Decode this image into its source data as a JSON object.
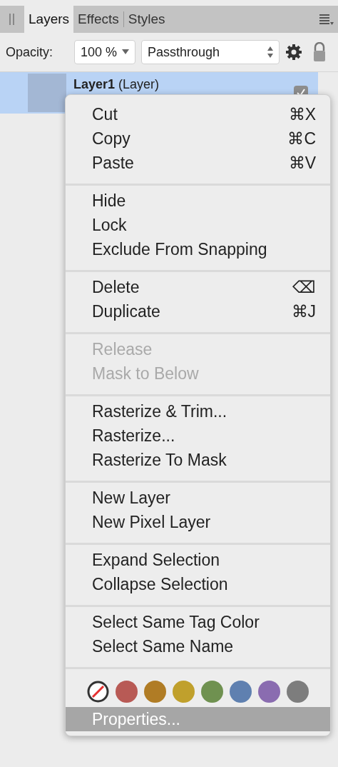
{
  "tabs": [
    {
      "label": "Layers",
      "selected": true
    },
    {
      "label": "Effects",
      "selected": false
    },
    {
      "label": "Styles",
      "selected": false
    }
  ],
  "toolbar": {
    "opacity_label": "Opacity:",
    "opacity_value": "100 %",
    "blend_mode": "Passthrough"
  },
  "layers": [
    {
      "name": "**Layer1** (Layer)",
      "selected": true,
      "visible": true
    }
  ],
  "context_menu": {
    "sections": [
      {
        "items": [
          {
            "label": "Cut",
            "shortcut": "⌘X",
            "disabled": false,
            "selected": false
          },
          {
            "label": "Copy",
            "shortcut": "⌘C",
            "disabled": false,
            "selected": false
          },
          {
            "label": "Paste",
            "shortcut": "⌘V",
            "disabled": false,
            "selected": false
          }
        ]
      },
      {
        "items": [
          {
            "label": "Hide",
            "disabled": false,
            "selected": false
          },
          {
            "label": "Lock",
            "disabled": false,
            "selected": false
          },
          {
            "label": "Exclude From Snapping",
            "disabled": false,
            "selected": false
          }
        ]
      },
      {
        "items": [
          {
            "label": "Delete",
            "shortcut": "⌫",
            "disabled": false,
            "selected": false
          },
          {
            "label": "Duplicate",
            "shortcut": "⌘J",
            "disabled": false,
            "selected": false
          }
        ]
      },
      {
        "items": [
          {
            "label": "Release",
            "disabled": true,
            "selected": false
          },
          {
            "label": "Mask to Below",
            "disabled": true,
            "selected": false
          }
        ]
      },
      {
        "items": [
          {
            "label": "Rasterize & Trim...",
            "disabled": false,
            "selected": false
          },
          {
            "label": "Rasterize...",
            "disabled": false,
            "selected": false
          },
          {
            "label": "Rasterize To Mask",
            "disabled": false,
            "selected": false
          }
        ]
      },
      {
        "items": [
          {
            "label": "New Layer",
            "disabled": false,
            "selected": false
          },
          {
            "label": "New Pixel Layer",
            "disabled": false,
            "selected": false
          }
        ]
      },
      {
        "items": [
          {
            "label": "Expand Selection",
            "disabled": false,
            "selected": false
          },
          {
            "label": "Collapse Selection",
            "disabled": false,
            "selected": false
          }
        ]
      },
      {
        "items": [
          {
            "label": "Select Same Tag Color",
            "disabled": false,
            "selected": false
          },
          {
            "label": "Select Same Name",
            "disabled": false,
            "selected": false
          }
        ]
      }
    ],
    "tag_colors": [
      {
        "kind": "none"
      },
      {
        "kind": "color",
        "color": "#b85a55"
      },
      {
        "kind": "color",
        "color": "#b07c25"
      },
      {
        "kind": "color",
        "color": "#c0a02c"
      },
      {
        "kind": "color",
        "color": "#6f9150"
      },
      {
        "kind": "color",
        "color": "#5f80b0"
      },
      {
        "kind": "color",
        "color": "#8a6cb0"
      },
      {
        "kind": "color",
        "color": "#7d7d7d"
      }
    ],
    "footer_items": [
      {
        "label": "Properties...",
        "disabled": false,
        "selected": true
      }
    ]
  }
}
